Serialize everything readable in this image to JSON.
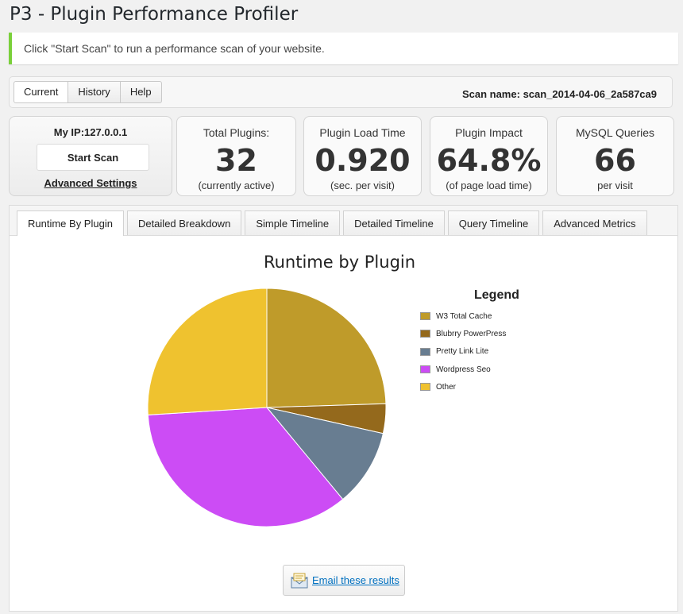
{
  "page": {
    "title": "P3 - Plugin Performance Profiler"
  },
  "notice": {
    "text": "Click \"Start Scan\" to run a performance scan of your website."
  },
  "top_tabs": [
    {
      "label": "Current"
    },
    {
      "label": "History"
    },
    {
      "label": "Help"
    }
  ],
  "scan": {
    "label": "Scan name:",
    "name": "scan_2014-04-06_2a587ca9"
  },
  "ip_box": {
    "label": "My IP:127.0.0.1",
    "start_button": "Start Scan",
    "advanced_link": "Advanced Settings"
  },
  "stats": [
    {
      "label": "Total Plugins:",
      "value": "32",
      "sub": "(currently active)"
    },
    {
      "label": "Plugin Load Time",
      "value": "0.920",
      "sub": "(sec. per visit)"
    },
    {
      "label": "Plugin Impact",
      "value": "64.8%",
      "sub": "(of page load time)"
    },
    {
      "label": "MySQL Queries",
      "value": "66",
      "sub": "per visit"
    }
  ],
  "tabs": [
    {
      "label": "Runtime By Plugin"
    },
    {
      "label": "Detailed Breakdown"
    },
    {
      "label": "Simple Timeline"
    },
    {
      "label": "Detailed Timeline"
    },
    {
      "label": "Query Timeline"
    },
    {
      "label": "Advanced Metrics"
    }
  ],
  "email_button": {
    "label": "Email these results",
    "icon": "envelope-icon"
  },
  "chart_data": {
    "type": "pie",
    "title": "Runtime by Plugin",
    "legend_title": "Legend",
    "legend_position": "right",
    "slices": [
      {
        "label": "W3 Total Cache",
        "value": 24.5,
        "color": "#bf9b2a"
      },
      {
        "label": "Blubrry PowerPress",
        "value": 4.0,
        "color": "#94691c"
      },
      {
        "label": "Pretty Link Lite",
        "value": 10.5,
        "color": "#687d91"
      },
      {
        "label": "Wordpress Seo",
        "value": 35.0,
        "color": "#cc4cf5"
      },
      {
        "label": "Other",
        "value": 26.0,
        "color": "#efc22f"
      }
    ]
  }
}
